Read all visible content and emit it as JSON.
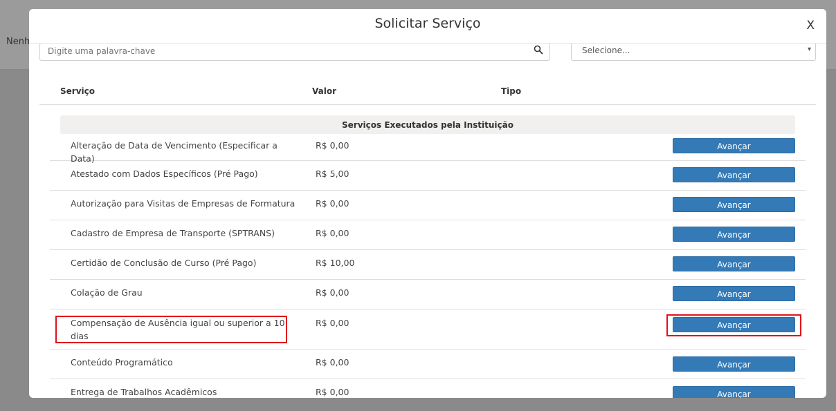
{
  "background": {
    "fragment_text": "Nenh"
  },
  "modal": {
    "title": "Solicitar Serviço",
    "close_label": "X"
  },
  "filters": {
    "search_placeholder": "Digite uma palavra-chave",
    "select_value": "Selecione..."
  },
  "table": {
    "columns": [
      "Serviço",
      "Valor",
      "Tipo"
    ],
    "group_title": "Serviços Executados pela Instituição",
    "button_label": "Avançar",
    "rows": [
      {
        "name": "Alteração de Data de Vencimento (Especificar a Data)",
        "value": "R$ 0,00"
      },
      {
        "name": "Atestado com Dados Específicos (Pré Pago)",
        "value": "R$ 5,00"
      },
      {
        "name": "Autorização para Visitas de Empresas de Formatura",
        "value": "R$ 0,00"
      },
      {
        "name": "Cadastro de Empresa de Transporte (SPTRANS)",
        "value": "R$ 0,00"
      },
      {
        "name": "Certidão de Conclusão de Curso (Pré Pago)",
        "value": "R$ 10,00"
      },
      {
        "name": "Colação de Grau",
        "value": "R$ 0,00"
      },
      {
        "name": "Compensação de Ausência igual ou superior a 10 dias",
        "value": "R$ 0,00",
        "highlighted": true
      },
      {
        "name": "Conteúdo Programático",
        "value": "R$ 0,00"
      },
      {
        "name": "Entrega de Trabalhos Acadêmicos",
        "value": "R$ 0,00"
      }
    ]
  },
  "colors": {
    "button": "#337ab7",
    "highlight": "#e0111b",
    "group_bg": "#f1f0ee"
  }
}
